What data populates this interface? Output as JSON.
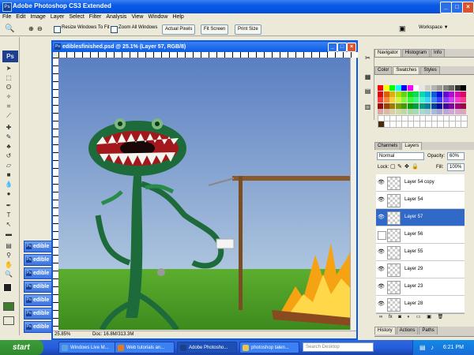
{
  "app": {
    "title": "Adobe Photoshop CS3 Extended",
    "logo": "Ps"
  },
  "menu": [
    "File",
    "Edit",
    "Image",
    "Layer",
    "Select",
    "Filter",
    "Analysis",
    "View",
    "Window",
    "Help"
  ],
  "options": {
    "resize_windows": "Resize Windows To Fit",
    "zoom_all": "Zoom All Windows",
    "actual_pixels": "Actual Pixels",
    "fit_screen": "Fit Screen",
    "print_size": "Print Size",
    "workspace": "Workspace ▼"
  },
  "minimized_docs": [
    "edible",
    "edible",
    "edible",
    "edible",
    "edible",
    "edible",
    "edible"
  ],
  "document": {
    "title": "ediblesfinished.psd @ 25.1% (Layer 57, RGB/8)",
    "zoom": "25.85%",
    "doc_size": "Doc: 16.8M/313.3M"
  },
  "panels": {
    "top_tabs": [
      "Navigator",
      "Histogram",
      "Info"
    ],
    "color_tabs": [
      "Color",
      "Swatches",
      "Styles"
    ],
    "layer_tabs": [
      "Channels",
      "Layers"
    ],
    "blend_mode": "Normal",
    "opacity_label": "Opacity:",
    "opacity": "60%",
    "lock_label": "Lock:",
    "fill_label": "Fill:",
    "fill": "100%",
    "bottom_tabs": [
      "History",
      "Actions",
      "Paths"
    ]
  },
  "layers": [
    {
      "name": "Layer 54 copy",
      "visible": true,
      "selected": false
    },
    {
      "name": "Layer 54",
      "visible": true,
      "selected": false
    },
    {
      "name": "Layer 57",
      "visible": true,
      "selected": true
    },
    {
      "name": "Layer 56",
      "visible": false,
      "selected": false
    },
    {
      "name": "Layer 55",
      "visible": true,
      "selected": false
    },
    {
      "name": "Layer 29",
      "visible": true,
      "selected": false
    },
    {
      "name": "Layer 23",
      "visible": true,
      "selected": false
    },
    {
      "name": "Layer 28",
      "visible": true,
      "selected": false
    }
  ],
  "taskbar": {
    "start": "start",
    "items": [
      {
        "label": "Windows Live M...",
        "color": "#5aa0e0"
      },
      {
        "label": "Web tutorials an...",
        "color": "#e27b1c"
      },
      {
        "label": "Adobe Photosho...",
        "color": "#1d3f8e"
      },
      {
        "label": "photoshop talen...",
        "color": "#e8c64a"
      }
    ],
    "search": "Search Desktop",
    "clock": "6:21 PM"
  }
}
